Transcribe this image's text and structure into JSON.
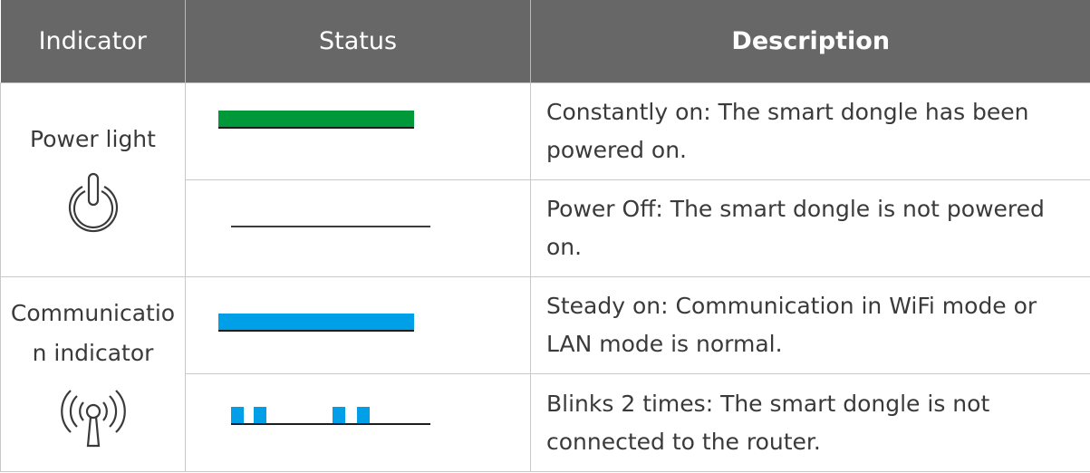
{
  "header": {
    "indicator": "Indicator",
    "status": "Status",
    "description": "Description"
  },
  "rows": [
    {
      "indicator": "Power light",
      "icon": "power-icon",
      "states": [
        {
          "status": "solid-green",
          "color": "#00993a",
          "description": "Constantly on: The smart dongle has been powered on."
        },
        {
          "status": "off",
          "color": "#3c3c3c",
          "description": "Power Off: The smart dongle is not powered on."
        }
      ]
    },
    {
      "indicator": "Communication indicator",
      "indicator_line1": "Communicatio",
      "indicator_line2": "n indicator",
      "icon": "wireless-signal-icon",
      "states": [
        {
          "status": "solid-blue",
          "color": "#00a0e9",
          "description": "Steady on: Communication in WiFi mode or LAN mode is normal."
        },
        {
          "status": "blink-2-times",
          "color": "#00a0e9",
          "description": "Blinks 2 times: The smart dongle is not connected to the router."
        }
      ]
    }
  ]
}
